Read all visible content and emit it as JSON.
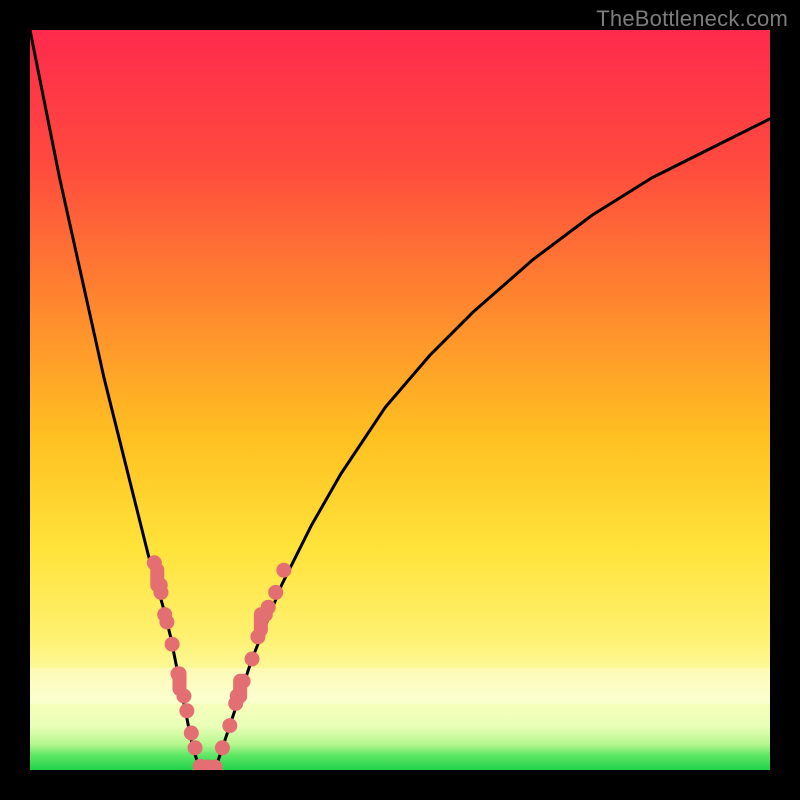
{
  "watermark": "TheBottleneck.com",
  "colors": {
    "top": "#ff2a4d",
    "upper_mid": "#ff6a33",
    "mid": "#ffd11a",
    "lower_mid": "#ffe34a",
    "pale": "#fff39a",
    "white_band": "#f6ffcf",
    "green_light": "#7fe96f",
    "green": "#1fd44a",
    "curve": "#000000",
    "marker": "#e46f73",
    "frame": "#000000"
  },
  "chart_data": {
    "type": "line",
    "title": "",
    "xlabel": "",
    "ylabel": "",
    "xlim": [
      0,
      100
    ],
    "ylim": [
      0,
      100
    ],
    "x": [
      0,
      2,
      4,
      6,
      8,
      10,
      12,
      14,
      16,
      18,
      19,
      20,
      21,
      22,
      23,
      24,
      25,
      26,
      28,
      30,
      34,
      38,
      42,
      48,
      54,
      60,
      68,
      76,
      84,
      92,
      100
    ],
    "y": [
      100,
      90,
      80,
      71,
      62,
      53,
      45,
      37,
      29,
      22,
      18,
      13,
      8,
      3,
      0,
      0,
      0,
      3,
      9,
      15,
      25,
      33,
      40,
      49,
      56,
      62,
      69,
      75,
      80,
      84,
      88
    ],
    "markers": [
      {
        "x": 16.8,
        "y": 28
      },
      {
        "x": 17.6,
        "y": 25
      },
      {
        "x": 17.7,
        "y": 24
      },
      {
        "x": 18.2,
        "y": 21
      },
      {
        "x": 18.5,
        "y": 20
      },
      {
        "x": 19.2,
        "y": 17
      },
      {
        "x": 20.0,
        "y": 13
      },
      {
        "x": 20.8,
        "y": 10
      },
      {
        "x": 21.2,
        "y": 8
      },
      {
        "x": 21.8,
        "y": 5
      },
      {
        "x": 22.3,
        "y": 3
      },
      {
        "x": 23.0,
        "y": 0.5
      },
      {
        "x": 24.0,
        "y": 0.4
      },
      {
        "x": 25.0,
        "y": 0.4
      },
      {
        "x": 26.0,
        "y": 3
      },
      {
        "x": 27.0,
        "y": 6
      },
      {
        "x": 27.8,
        "y": 9
      },
      {
        "x": 28.0,
        "y": 10
      },
      {
        "x": 28.8,
        "y": 12
      },
      {
        "x": 30.0,
        "y": 15
      },
      {
        "x": 30.8,
        "y": 18
      },
      {
        "x": 31.8,
        "y": 21
      },
      {
        "x": 32.2,
        "y": 22
      },
      {
        "x": 33.2,
        "y": 24
      },
      {
        "x": 34.3,
        "y": 27
      }
    ],
    "elongated_markers": [
      {
        "x": 17.2,
        "y0": 24,
        "y1": 28
      },
      {
        "x": 20.2,
        "y0": 10,
        "y1": 14
      },
      {
        "x": 28.4,
        "y0": 9,
        "y1": 13
      },
      {
        "x": 31.2,
        "y0": 18,
        "y1": 22
      }
    ]
  }
}
